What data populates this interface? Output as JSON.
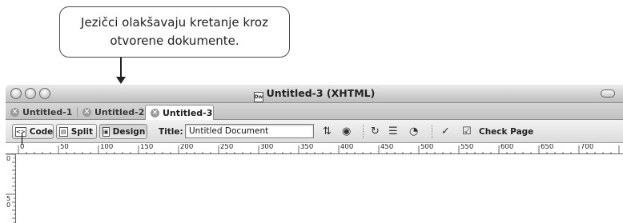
{
  "callout": {
    "line1": "Jezičci olakšavaju kretanje kroz",
    "line2": "otvorene dokumente."
  },
  "window": {
    "title": "Untitled-3 (XHTML)",
    "doc_icon": "Dw"
  },
  "tabs": [
    {
      "label": "Untitled-1"
    },
    {
      "label": "Untitled-2"
    },
    {
      "label": "Untitled-3"
    }
  ],
  "toolbar": {
    "code_label": "Code",
    "split_label": "Split",
    "design_label": "Design",
    "title_label": "Title:",
    "title_value": "Untitled Document",
    "check_page_label": "Check Page"
  },
  "ruler": {
    "h_labels": [
      "0",
      "50",
      "100",
      "150",
      "200",
      "250",
      "300",
      "350",
      "400",
      "450",
      "500",
      "550",
      "600",
      "650",
      "700"
    ],
    "v_labels": [
      "0",
      "50"
    ]
  },
  "colors": {
    "chrome": "#d6d6d6",
    "border": "#8c8c8c",
    "text": "#222222"
  }
}
